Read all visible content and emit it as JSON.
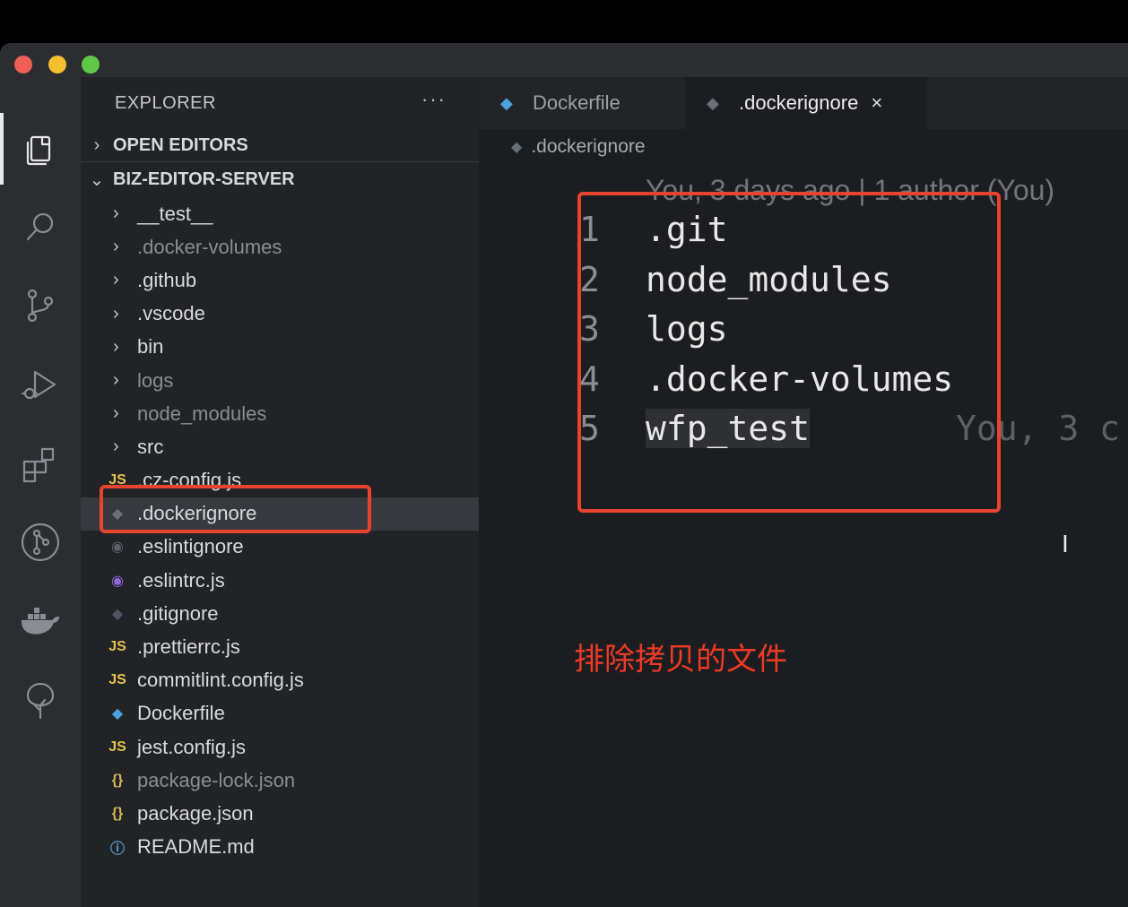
{
  "window": {
    "controls": [
      "close",
      "minimize",
      "maximize"
    ]
  },
  "activity_bar": {
    "items": [
      {
        "name": "explorer-icon",
        "active": true
      },
      {
        "name": "search-icon"
      },
      {
        "name": "source-control-icon"
      },
      {
        "name": "run-debug-icon"
      },
      {
        "name": "extensions-icon"
      },
      {
        "name": "git-graph-icon"
      },
      {
        "name": "docker-icon"
      },
      {
        "name": "tree-icon"
      }
    ]
  },
  "sidebar": {
    "title": "EXPLORER",
    "more": "···",
    "open_editors": "OPEN EDITORS",
    "project": "BIZ-EDITOR-SERVER",
    "items": [
      {
        "label": "__test__",
        "type": "folder",
        "dim": false
      },
      {
        "label": ".docker-volumes",
        "type": "folder",
        "dim": true
      },
      {
        "label": ".github",
        "type": "folder",
        "dim": false
      },
      {
        "label": ".vscode",
        "type": "folder",
        "dim": false
      },
      {
        "label": "bin",
        "type": "folder",
        "dim": false
      },
      {
        "label": "logs",
        "type": "folder",
        "dim": true
      },
      {
        "label": "node_modules",
        "type": "folder",
        "dim": true
      },
      {
        "label": "src",
        "type": "folder",
        "dim": false
      },
      {
        "label": ".cz-config.js",
        "type": "js",
        "icon": "JS"
      },
      {
        "label": ".dockerignore",
        "type": "docker",
        "icon": "docker-icon",
        "selected": true
      },
      {
        "label": ".eslintignore",
        "type": "eslint-ignore",
        "icon": "eslint-ignore-icon"
      },
      {
        "label": ".eslintrc.js",
        "type": "eslint",
        "icon": "eslint-icon"
      },
      {
        "label": ".gitignore",
        "type": "git",
        "icon": "git-icon"
      },
      {
        "label": ".prettierrc.js",
        "type": "js",
        "icon": "JS"
      },
      {
        "label": "commitlint.config.js",
        "type": "js",
        "icon": "JS"
      },
      {
        "label": "Dockerfile",
        "type": "docker",
        "icon": "docker-icon"
      },
      {
        "label": "jest.config.js",
        "type": "js",
        "icon": "JS"
      },
      {
        "label": "package-lock.json",
        "type": "json",
        "icon": "{}",
        "dim": true
      },
      {
        "label": "package.json",
        "type": "json",
        "icon": "{}"
      },
      {
        "label": "README.md",
        "type": "info",
        "icon": "info-icon"
      }
    ]
  },
  "editor": {
    "tabs": [
      {
        "label": "Dockerfile",
        "active": false
      },
      {
        "label": ".dockerignore",
        "active": true,
        "close": "×"
      }
    ],
    "breadcrumb": ".dockerignore",
    "blame_header": "You, 3 days ago | 1 author (You)",
    "lines": [
      {
        "number": "1",
        "text": ".git"
      },
      {
        "number": "2",
        "text": "node_modules"
      },
      {
        "number": "3",
        "text": "logs"
      },
      {
        "number": "4",
        "text": ".docker-volumes"
      },
      {
        "number": "5",
        "text": "wfp_test",
        "ghost": "You, 3 c"
      }
    ],
    "text_cursor": "I"
  },
  "annotation": {
    "note": "排除拷贝的文件",
    "color": "#e8432f"
  }
}
